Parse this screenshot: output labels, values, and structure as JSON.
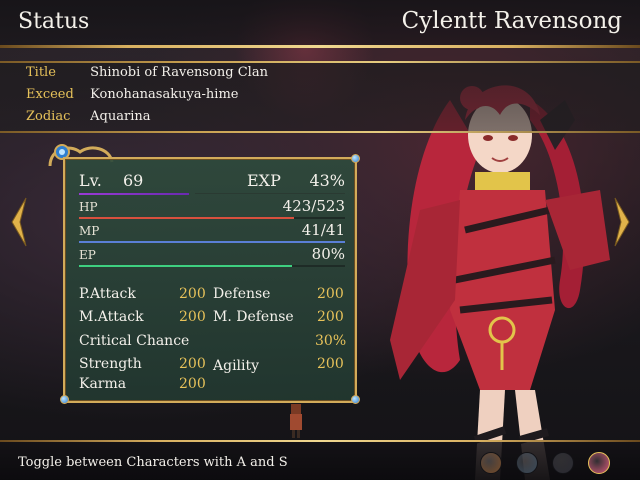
{
  "screen": {
    "title": "Status",
    "character_name": "Cylentt Ravensong"
  },
  "profile": [
    {
      "key": "Title",
      "value": "Shinobi of Ravensong Clan"
    },
    {
      "key": "Exceed",
      "value": "Konohanasakuya-hime"
    },
    {
      "key": "Zodiac",
      "value": "Aquarina"
    }
  ],
  "level": {
    "label": "Lv.",
    "value": "69",
    "exp_label": "EXP",
    "exp_value": "43%"
  },
  "gauges": {
    "hp": {
      "label": "HP",
      "value": "423/523",
      "fraction": 0.81,
      "color": "#d8503e"
    },
    "mp": {
      "label": "MP",
      "value": "41/41",
      "fraction": 1.0,
      "color": "#5a7fd6"
    },
    "ep": {
      "label": "EP",
      "value": "80%",
      "fraction": 0.8,
      "color": "#3ed080"
    }
  },
  "stats": {
    "p_attack": {
      "label": "P.Attack",
      "value": "200"
    },
    "defense": {
      "label": "Defense",
      "value": "200"
    },
    "m_attack": {
      "label": "M.Attack",
      "value": "200"
    },
    "m_defense": {
      "label": "M. Defense",
      "value": "200"
    },
    "critical": {
      "label": "Critical Chance",
      "value": "30%"
    },
    "strength": {
      "label": "Strength",
      "value": "200"
    },
    "agility": {
      "label": "Agility",
      "value": "200"
    },
    "karma": {
      "label": "Karma",
      "value": "200"
    }
  },
  "footer": {
    "hint": "Toggle between Characters with A and S"
  },
  "party_faces": [
    {
      "icon": "party-member-1-face-icon",
      "color": "#7a4e2a"
    },
    {
      "icon": "party-member-2-face-icon",
      "color": "#3a4a5a"
    },
    {
      "icon": "party-member-3-face-icon",
      "color": "#2a2a32"
    },
    {
      "icon": "party-member-4-face-icon",
      "color": "#d65a7a"
    }
  ],
  "colors": {
    "accent_gold": "#e7c25a",
    "panel_green": "#2e4a3c",
    "level_bar": "#9a3ad6"
  }
}
